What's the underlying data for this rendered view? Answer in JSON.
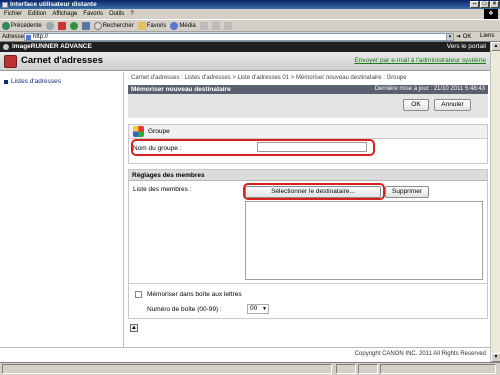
{
  "window": {
    "title": "Interface utilisateur distante"
  },
  "menu": [
    "Fichier",
    "Edition",
    "Affichage",
    "Favoris",
    "Outils",
    "?"
  ],
  "toolbar": {
    "back_label": "Précédente",
    "search_label": "Rechercher",
    "favorites_label": "Favoris",
    "media_label": "Média"
  },
  "address": {
    "label": "Adresse",
    "value": "http://",
    "go_label": "OK",
    "links_label": "Liens"
  },
  "header": {
    "product": "imageRUNNER ADVANCE",
    "portal_link": "Vers le portail"
  },
  "subheader": {
    "title": "Carnet d'adresses",
    "email_link": "Envoyer par e-mail à l'administrateur système"
  },
  "sidebar": {
    "items": [
      {
        "label": "Listes d'adresses"
      }
    ]
  },
  "breadcrumb": "Carnet d'adresses : Listes d'adresses > Liste d'adresses 01 > Mémoriser nouveau destinataire : Groupe",
  "panel": {
    "title": "Mémoriser nouveau destinataire",
    "last_update": "Dernière mise à jour : 21/10 2011 5:48:43",
    "ok_label": "OK",
    "cancel_label": "Annuler"
  },
  "group": {
    "section_label": "Groupe",
    "name_label": "Nom du groupe :",
    "name_value": ""
  },
  "members": {
    "section_title": "Réglages des membres",
    "list_label": "Liste des membres :",
    "select_label": "Sélectionner le destinataire...",
    "delete_label": "Supprimer",
    "store_label": "Mémoriser dans boîte aux lettres",
    "box_number_label": "Numéro de boîte (00-99) :",
    "box_number_value": "00"
  },
  "footer": {
    "copyright": "Copyright CANON INC. 2011 All Rights Reserved"
  }
}
